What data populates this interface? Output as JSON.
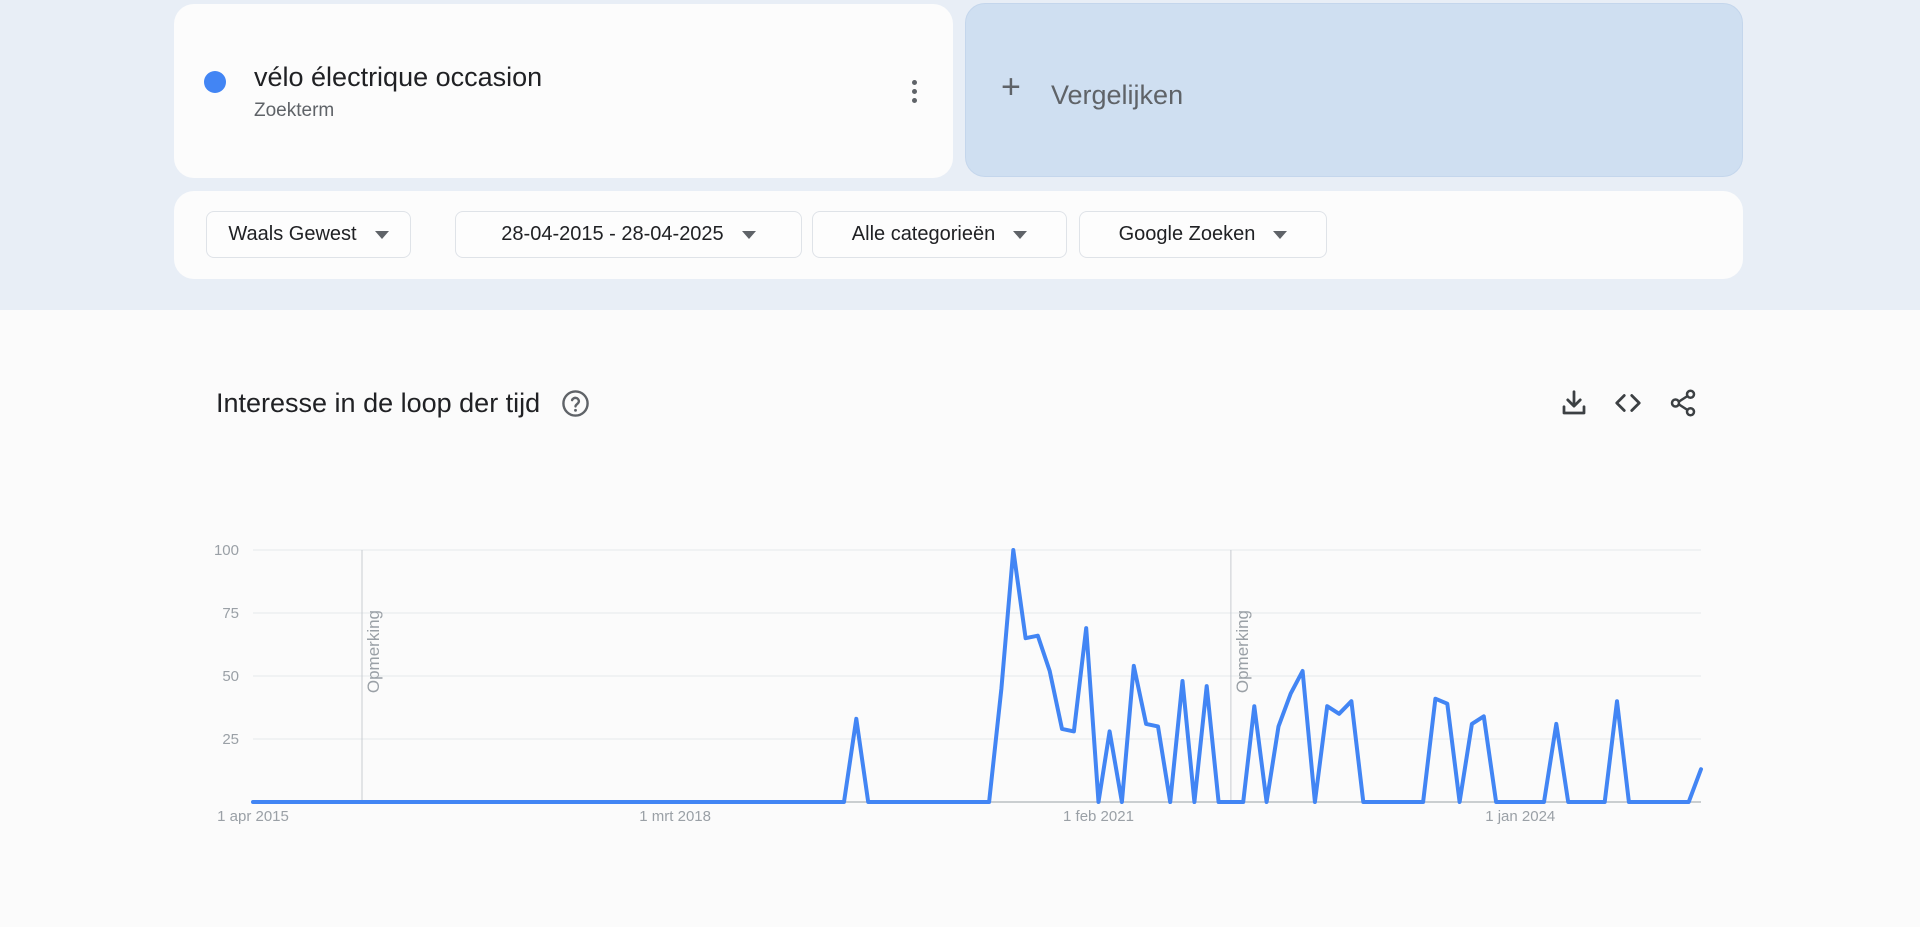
{
  "search_term": {
    "name": "vélo électrique occasion",
    "type": "Zoekterm",
    "color": "#4285f4"
  },
  "compare": {
    "label": "Vergelijken"
  },
  "filters": [
    {
      "label": "Waals Gewest"
    },
    {
      "label": "28-04-2015 - 28-04-2025"
    },
    {
      "label": "Alle categorieën"
    },
    {
      "label": "Google Zoeken"
    }
  ],
  "section": {
    "title": "Interesse in de loop der tijd",
    "icons": [
      "help-icon",
      "download-icon",
      "embed-icon",
      "share-icon"
    ]
  },
  "chart_data": {
    "type": "line",
    "title": "",
    "xlabel": "",
    "ylabel": "",
    "x_tick_labels": [
      "1 apr 2015",
      "1 mrt 2018",
      "1 feb 2021",
      "1 jan 2024"
    ],
    "x_tick_dates": [
      "2015-04-01",
      "2018-03-01",
      "2021-02-01",
      "2024-01-01"
    ],
    "xlim": [
      "2015-04-01",
      "2025-04-01"
    ],
    "y_ticks": [
      25,
      50,
      75,
      100
    ],
    "ylim": [
      0,
      100
    ],
    "grid": true,
    "notes": [
      {
        "label": "Opmerking",
        "date": "2016-01-01"
      },
      {
        "label": "Opmerking",
        "date": "2022-01-01"
      }
    ],
    "series": [
      {
        "color": "#4285f4",
        "points": [
          [
            "2015-04-01",
            0
          ],
          [
            "2019-05-01",
            0
          ],
          [
            "2019-06-01",
            33
          ],
          [
            "2019-07-01",
            0
          ],
          [
            "2020-05-01",
            0
          ],
          [
            "2020-06-01",
            45
          ],
          [
            "2020-07-01",
            100
          ],
          [
            "2020-08-01",
            65
          ],
          [
            "2020-09-01",
            66
          ],
          [
            "2020-10-01",
            52
          ],
          [
            "2020-11-01",
            29
          ],
          [
            "2020-12-01",
            28
          ],
          [
            "2021-01-01",
            69
          ],
          [
            "2021-02-01",
            0
          ],
          [
            "2021-03-01",
            28
          ],
          [
            "2021-04-01",
            0
          ],
          [
            "2021-05-01",
            54
          ],
          [
            "2021-06-01",
            31
          ],
          [
            "2021-07-01",
            30
          ],
          [
            "2021-08-01",
            0
          ],
          [
            "2021-09-01",
            48
          ],
          [
            "2021-10-01",
            0
          ],
          [
            "2021-11-01",
            46
          ],
          [
            "2021-12-01",
            0
          ],
          [
            "2022-02-01",
            0
          ],
          [
            "2022-03-01",
            38
          ],
          [
            "2022-04-01",
            0
          ],
          [
            "2022-05-01",
            30
          ],
          [
            "2022-06-01",
            43
          ],
          [
            "2022-07-01",
            52
          ],
          [
            "2022-08-01",
            0
          ],
          [
            "2022-09-01",
            38
          ],
          [
            "2022-10-01",
            35
          ],
          [
            "2022-11-01",
            40
          ],
          [
            "2022-12-01",
            0
          ],
          [
            "2023-05-01",
            0
          ],
          [
            "2023-06-01",
            41
          ],
          [
            "2023-07-01",
            39
          ],
          [
            "2023-08-01",
            0
          ],
          [
            "2023-09-01",
            31
          ],
          [
            "2023-10-01",
            34
          ],
          [
            "2023-11-01",
            0
          ],
          [
            "2024-03-01",
            0
          ],
          [
            "2024-04-01",
            31
          ],
          [
            "2024-05-01",
            0
          ],
          [
            "2024-08-01",
            0
          ],
          [
            "2024-09-01",
            40
          ],
          [
            "2024-10-01",
            0
          ],
          [
            "2025-03-01",
            0
          ],
          [
            "2025-04-01",
            13
          ]
        ]
      }
    ]
  }
}
